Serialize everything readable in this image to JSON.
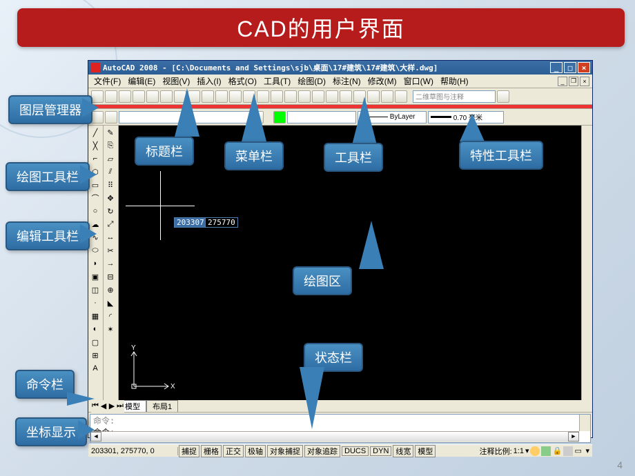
{
  "slide": {
    "title": "CAD的用户界面",
    "page_number": "4"
  },
  "window": {
    "title": "AutoCAD 2008 - [C:\\Documents and Settings\\sjb\\桌面\\17#建筑\\17#建筑\\大样.dwg]",
    "menus": [
      "文件(F)",
      "编辑(E)",
      "视图(V)",
      "插入(I)",
      "格式(O)",
      "工具(T)",
      "绘图(D)",
      "标注(N)",
      "修改(M)",
      "窗口(W)",
      "帮助(H)"
    ],
    "annot_combo": "二维草图与注释",
    "bylayer": "ByLayer",
    "lineweight": "0.70 毫米",
    "coord1": "203307",
    "coord2": "275770",
    "ucs_x": "X",
    "ucs_y": "Y",
    "tabs": [
      "模型",
      "布局1"
    ],
    "cmd_prev": "命令:",
    "cmd_cur": "命令:",
    "status_coords": "203301, 275770, 0",
    "status_buttons": [
      "捕捉",
      "栅格",
      "正交",
      "极轴",
      "对象捕捉",
      "对象追踪",
      "DUCS",
      "DYN",
      "线宽",
      "模型"
    ],
    "annot_scale_label": "注释比例:",
    "annot_scale_value": "1:1"
  },
  "callouts": {
    "layer_manager": "图层管理器",
    "draw_toolbar": "绘图工具栏",
    "edit_toolbar": "编辑工具栏",
    "command_bar": "命令栏",
    "coord_display": "坐标显示",
    "title_bar": "标题栏",
    "menu_bar": "菜单栏",
    "tool_bar": "工具栏",
    "prop_toolbar": "特性工具栏",
    "draw_area": "绘图区",
    "status_bar": "状态栏"
  }
}
